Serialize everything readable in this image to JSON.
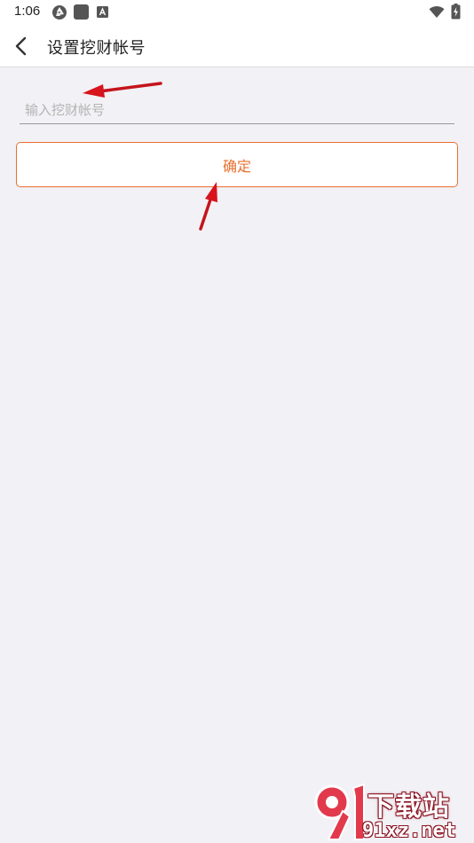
{
  "status_bar": {
    "time": "1:06"
  },
  "header": {
    "title": "设置挖财帐号",
    "back_icon": "chevron-left-icon"
  },
  "form": {
    "account_input": {
      "placeholder": "输入挖财帐号",
      "value": ""
    },
    "confirm_label": "确定"
  },
  "watermark": {
    "logo_text_top": "下载站",
    "logo_text_bottom": "91xz.net"
  },
  "colors": {
    "accent": "#e8702f",
    "background": "#f2f1f5",
    "annotation_arrow": "#e0141e"
  }
}
